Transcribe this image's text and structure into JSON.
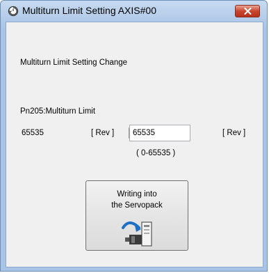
{
  "window": {
    "title": "Multiturn Limit Setting AXIS#00",
    "close_icon": "close-icon",
    "app_icon": "multiturn-icon"
  },
  "dialog": {
    "section_label": "Multiturn Limit Setting Change",
    "param_label": "Pn205:Multiturn Limit",
    "current_value": "65535",
    "current_unit": "[ Rev ]",
    "new_value": "65535",
    "new_unit": "[ Rev ]",
    "range_text": "( 0-65535 )",
    "write_button": {
      "line1": "Writing into",
      "line2": "the Servopack",
      "icon": "write-to-servopack-icon"
    }
  },
  "colors": {
    "title_bar": "#a9c4e6",
    "close_button": "#c7452e",
    "client_bg": "#f0f0f0"
  }
}
